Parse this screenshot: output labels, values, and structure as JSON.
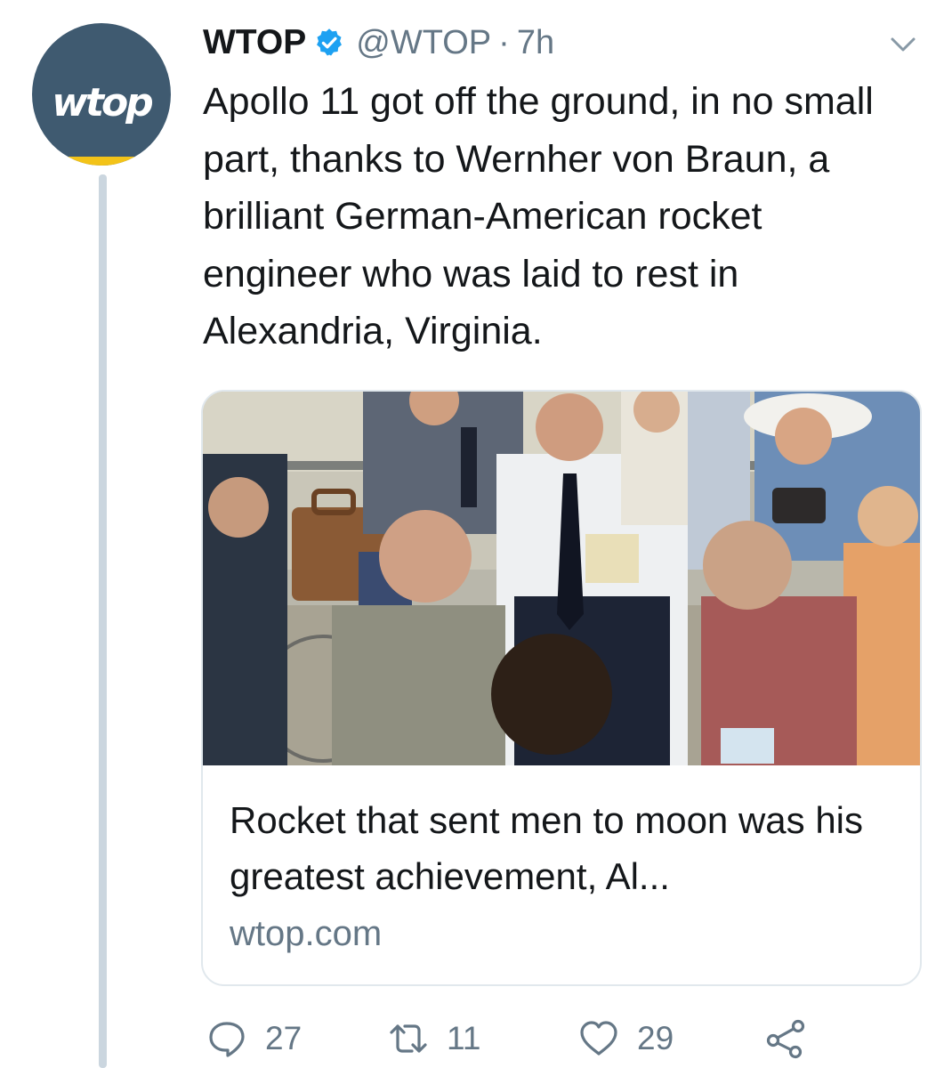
{
  "author": {
    "display_name": "WTOP",
    "handle": "@WTOP",
    "separator": "·",
    "time": "7h",
    "avatar_text": "wtop",
    "verified": true
  },
  "tweet": {
    "text": "Apollo 11 got off the ground, in no small part, thanks to Wernher von Braun, a brilliant German-American rocket engineer who was laid to rest in Alexandria, Virginia."
  },
  "card": {
    "title": "Rocket that sent men to moon was his greatest achievement, Al...",
    "domain": "wtop.com"
  },
  "actions": {
    "replies": "27",
    "retweets": "11",
    "likes": "29"
  },
  "colors": {
    "avatar_background": "#3f5a70",
    "avatar_stripe": "#f3c318",
    "verified_badge": "#1da1f2",
    "secondary_text": "#657786",
    "thread_line": "#cbd6df",
    "card_border": "#e1e8ed"
  },
  "icons": {
    "menu": "chevron-down-icon",
    "verified": "verified-badge-icon",
    "reply": "reply-icon",
    "retweet": "retweet-icon",
    "like": "heart-icon",
    "share": "share-icon"
  }
}
